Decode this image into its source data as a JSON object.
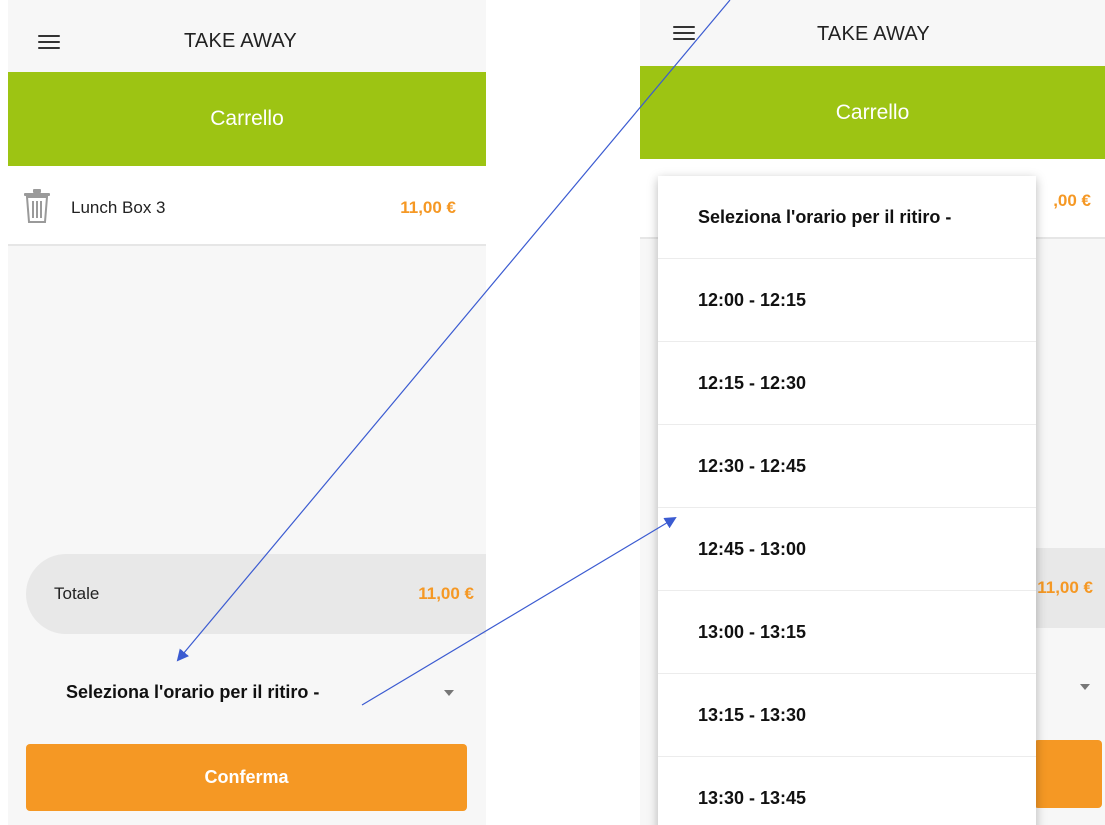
{
  "app": {
    "title": "TAKE AWAY",
    "header": "Carrello"
  },
  "colors": {
    "brand_green": "#9dc413",
    "accent_orange": "#f59824",
    "annotation_arrow": "#3b5bd1"
  },
  "cart": {
    "items": [
      {
        "name": "Lunch Box 3",
        "price": "11,00 €",
        "icon": "trash-icon"
      }
    ],
    "right_partial_price": ",00 €"
  },
  "totals": {
    "label": "Totale",
    "value": "11,00 €",
    "right_partial_value": "11,00 €"
  },
  "pickup": {
    "selected": "Seleziona l'orario per il ritiro -",
    "options": [
      "Seleziona l'orario per il ritiro -",
      "12:00 - 12:15",
      "12:15 - 12:30",
      "12:30 - 12:45",
      "12:45 - 13:00",
      "13:00 - 13:15",
      "13:15 - 13:30",
      "13:30 - 13:45"
    ]
  },
  "actions": {
    "confirm": "Conferma"
  }
}
